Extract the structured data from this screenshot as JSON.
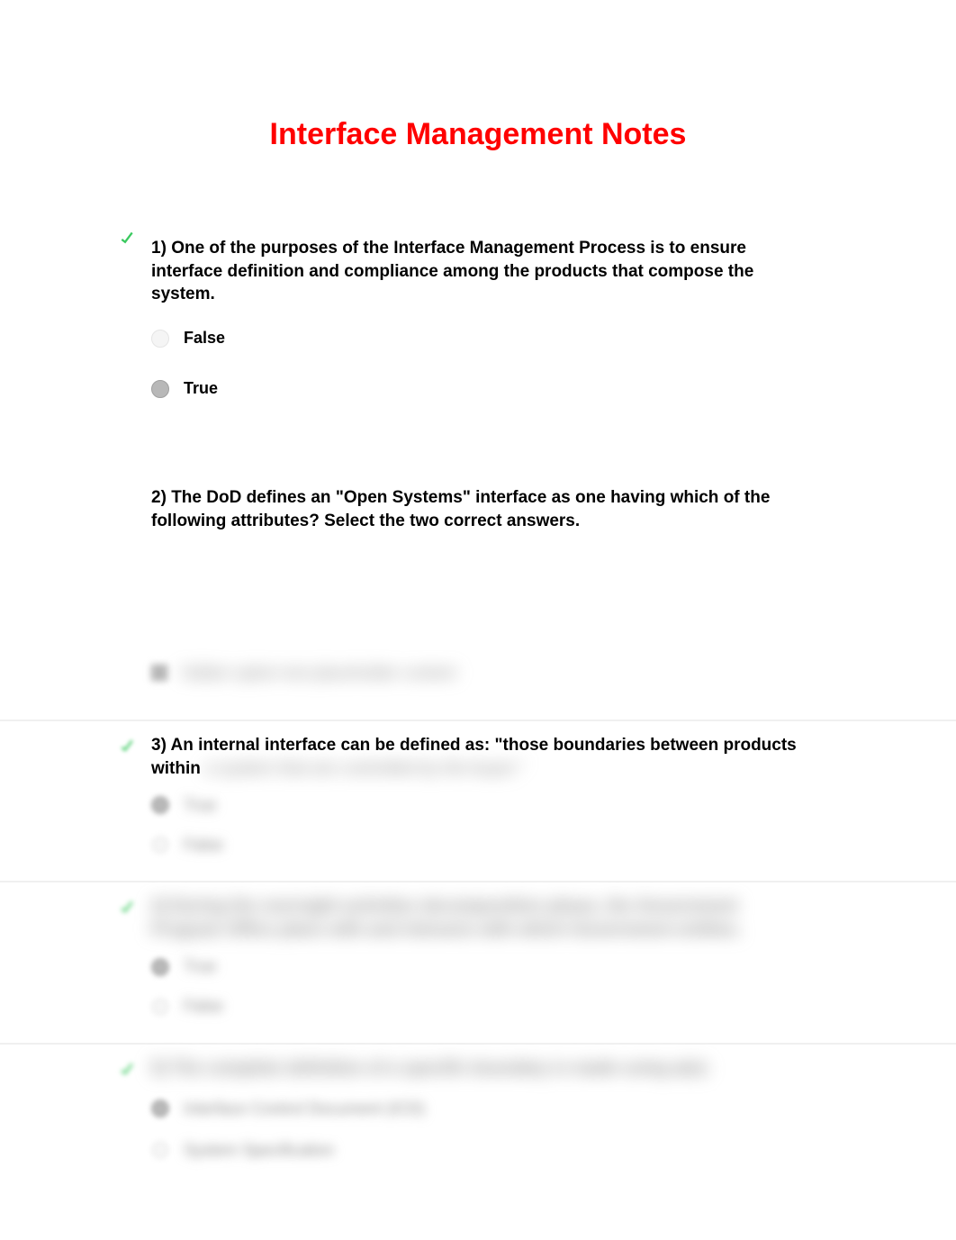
{
  "title": "Interface Management Notes",
  "questions": [
    {
      "number": "1)",
      "text": "One of the purposes of the Interface Management Process is to ensure interface definition and compliance among the products that compose the system.",
      "icon": "check",
      "options": [
        {
          "label": "False",
          "selected": false,
          "type": "radio"
        },
        {
          "label": "True",
          "selected": true,
          "type": "radio"
        }
      ]
    },
    {
      "number": "2)",
      "text": "The DoD defines an \"Open Systems\" interface as one having which of the following attributes? Select the two correct answers.",
      "icon": null,
      "options": []
    },
    {
      "number": "3)",
      "text": "An internal interface can be defined as: \"those boundaries between products within",
      "icon": "check",
      "hidden_suffix": "a system that are controlled by the buyer.\"",
      "options": [
        {
          "label": "True",
          "selected": true,
          "type": "radio",
          "blurred": true
        },
        {
          "label": "False",
          "selected": false,
          "type": "radio",
          "blurred": true
        }
      ]
    },
    {
      "number": "4)",
      "text": "During the oversight activities decomposition phase, the Government Program Office plans with and interacts with which Government entities.",
      "icon": "check",
      "blurred": true,
      "options": [
        {
          "label": "True",
          "selected": true,
          "type": "radio",
          "blurred": true
        },
        {
          "label": "False",
          "selected": false,
          "type": "radio",
          "blurred": true
        }
      ]
    },
    {
      "number": "5)",
      "text": "The complete definition of a specific boundary is made using a(n):",
      "icon": "check",
      "blurred": true,
      "options": [
        {
          "label": "Interface Control Document (ICD)",
          "selected": true,
          "type": "radio",
          "blurred": true
        },
        {
          "label": "System Specification",
          "selected": false,
          "type": "radio",
          "blurred": true
        }
      ]
    }
  ],
  "hidden_checkbox_option": "hidden option text placeholder content"
}
